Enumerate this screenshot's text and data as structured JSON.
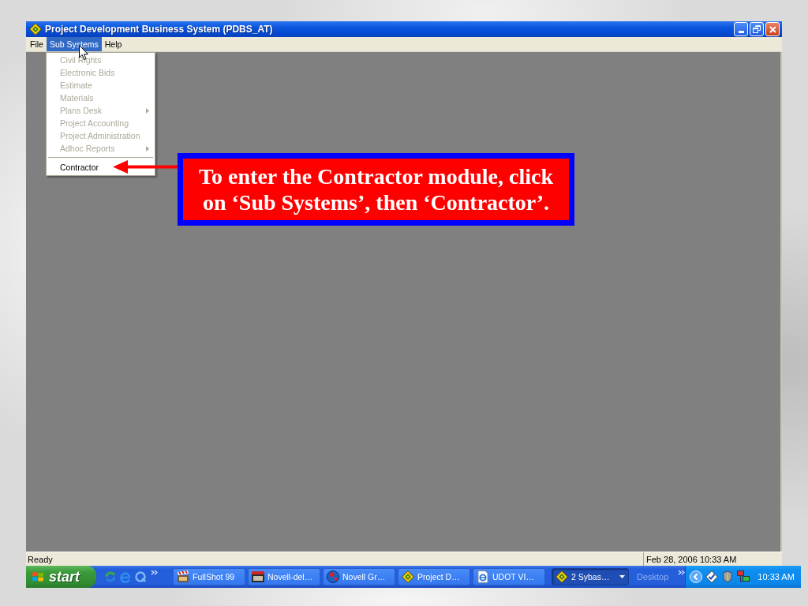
{
  "window": {
    "title": "Project Development Business System (PDBS_AT)",
    "menu_bar": [
      {
        "label": "File",
        "selected": false
      },
      {
        "label": "Sub Systems",
        "selected": true
      },
      {
        "label": "Help",
        "selected": false
      }
    ]
  },
  "sub_systems_menu": [
    {
      "kind": "item",
      "label": "Civil Rights",
      "disabled": true,
      "submenu": false
    },
    {
      "kind": "item",
      "label": "Electronic Bids",
      "disabled": true,
      "submenu": false
    },
    {
      "kind": "item",
      "label": "Estimate",
      "disabled": true,
      "submenu": false
    },
    {
      "kind": "item",
      "label": "Materials",
      "disabled": true,
      "submenu": false
    },
    {
      "kind": "item",
      "label": "Plans Desk",
      "disabled": true,
      "submenu": true
    },
    {
      "kind": "item",
      "label": "Project Accounting",
      "disabled": true,
      "submenu": false
    },
    {
      "kind": "item",
      "label": "Project Administration",
      "disabled": true,
      "submenu": false
    },
    {
      "kind": "item",
      "label": "Adhoc Reports",
      "disabled": true,
      "submenu": true
    },
    {
      "kind": "separator"
    },
    {
      "kind": "item",
      "label": "Contractor",
      "disabled": false,
      "submenu": false
    }
  ],
  "callout": {
    "text": "To enter the Contractor module, click on ‘Sub Systems’, then ‘Contractor’."
  },
  "status_bar": {
    "message": "Ready",
    "datetime": "Feb 28, 2006 10:33 AM"
  },
  "taskbar": {
    "start_label": "start",
    "tasks": [
      {
        "label": "FullShot 99",
        "selected": false,
        "grouped": false
      },
      {
        "label": "Novell-del…",
        "selected": false,
        "grouped": false
      },
      {
        "label": "Novell Gr…",
        "selected": false,
        "grouped": false
      },
      {
        "label": "Project D…",
        "selected": false,
        "grouped": false
      },
      {
        "label": "UDOT VI…",
        "selected": false,
        "grouped": false
      },
      {
        "label": "2 Sybas…",
        "selected": true,
        "grouped": true
      }
    ],
    "toolbar_label": "Desktop",
    "clock": "10:33 AM"
  }
}
